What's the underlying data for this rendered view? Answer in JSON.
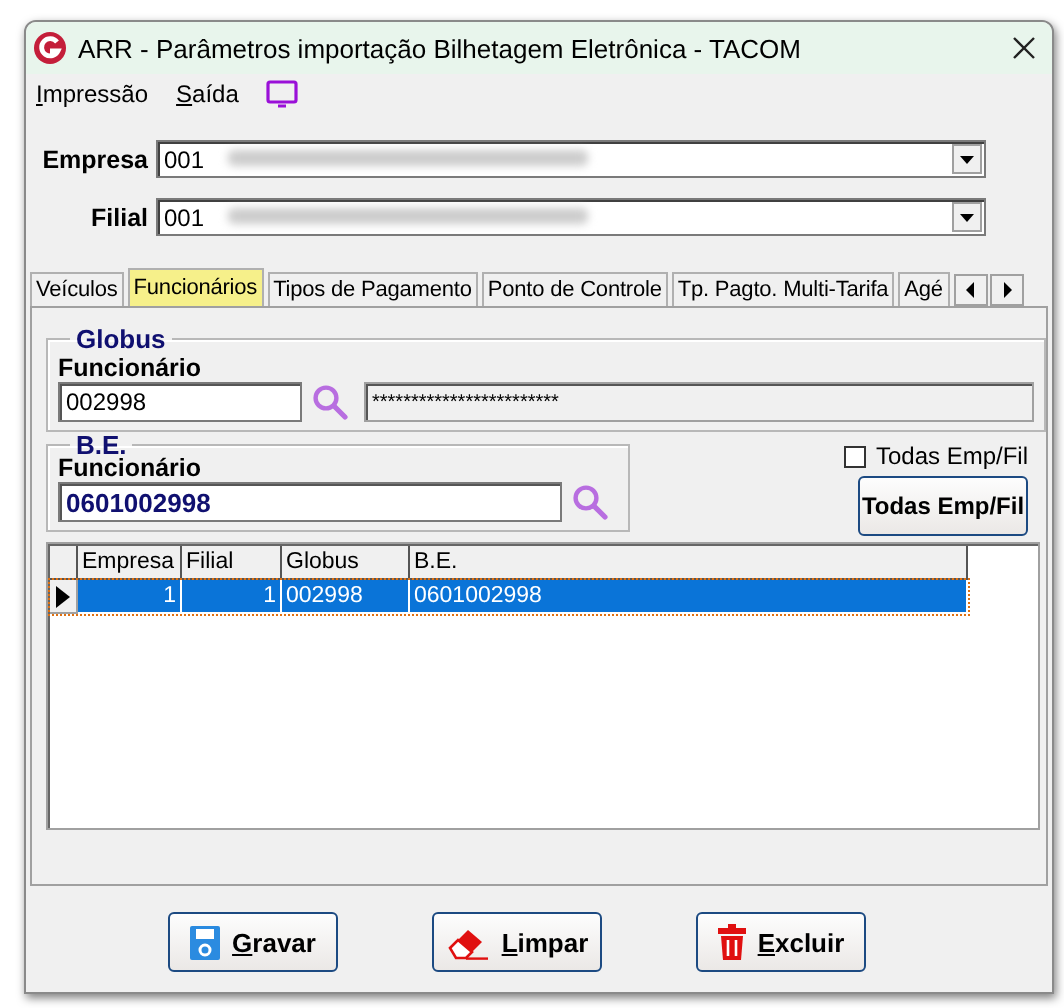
{
  "window": {
    "title": "ARR - Parâmetros importação Bilhetagem Eletrônica - TACOM"
  },
  "menu": [
    {
      "label": "Impressão"
    },
    {
      "label": "Saída"
    }
  ],
  "empresa": {
    "label": "Empresa",
    "value": "001"
  },
  "filial": {
    "label": "Filial",
    "value": "001"
  },
  "tabs": [
    {
      "label": "Veículos",
      "selected": false
    },
    {
      "label": "Funcionários",
      "selected": true
    },
    {
      "label": "Tipos de Pagamento",
      "selected": false
    },
    {
      "label": "Ponto de Controle",
      "selected": false
    },
    {
      "label": "Tp. Pagto. Multi-Tarifa",
      "selected": false
    },
    {
      "label": "Agé",
      "selected": false
    }
  ],
  "globus": {
    "title": "Globus",
    "field_label": "Funcionário",
    "value": "002998",
    "name": "************************"
  },
  "be": {
    "title": "B.E.",
    "field_label": "Funcionário",
    "value": "0601002998"
  },
  "todas_checkbox": {
    "label": "Todas Emp/Fil",
    "checked": false
  },
  "todas_button": {
    "label": "Todas Emp/Fil"
  },
  "table": {
    "columns": [
      "Empresa",
      "Filial",
      "Globus",
      "B.E."
    ],
    "rows": [
      {
        "cells": [
          "1",
          "1",
          "002998",
          "0601002998"
        ],
        "selected": true
      }
    ]
  },
  "buttons": [
    {
      "label": "Gravar",
      "kind": "save"
    },
    {
      "label": "Limpar",
      "kind": "clear"
    },
    {
      "label": "Excluir",
      "kind": "delete"
    }
  ]
}
